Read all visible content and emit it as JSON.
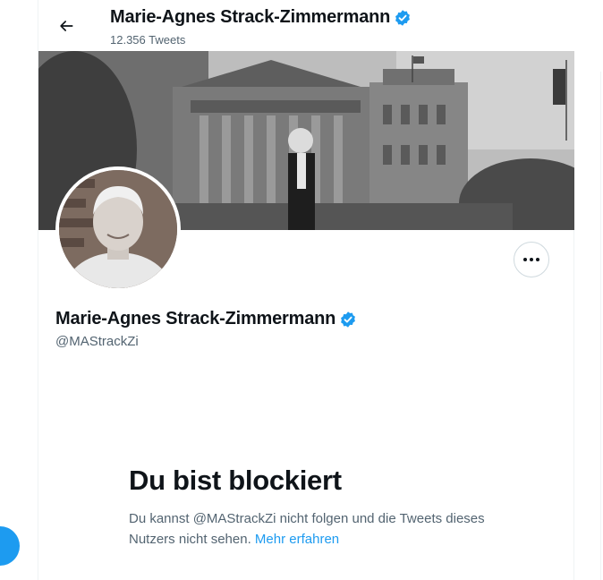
{
  "header": {
    "name": "Marie-Agnes Strack-Zimmermann",
    "tweet_count": "12.356 Tweets"
  },
  "profile": {
    "name": "Marie-Agnes Strack-Zimmermann",
    "handle": "@MAStrackZi",
    "verified": true
  },
  "blocked": {
    "title": "Du bist blockiert",
    "message": "Du kannst @MAStrackZi nicht folgen und die Tweets dieses Nutzers nicht sehen.",
    "link_label": "Mehr erfahren"
  },
  "colors": {
    "accent": "#1d9bf0",
    "text": "#0f1419",
    "secondary": "#536471",
    "border": "#cfd9de"
  },
  "icons": {
    "back": "arrow-left-icon",
    "verified": "verified-badge-icon",
    "more": "more-horizontal-icon"
  }
}
